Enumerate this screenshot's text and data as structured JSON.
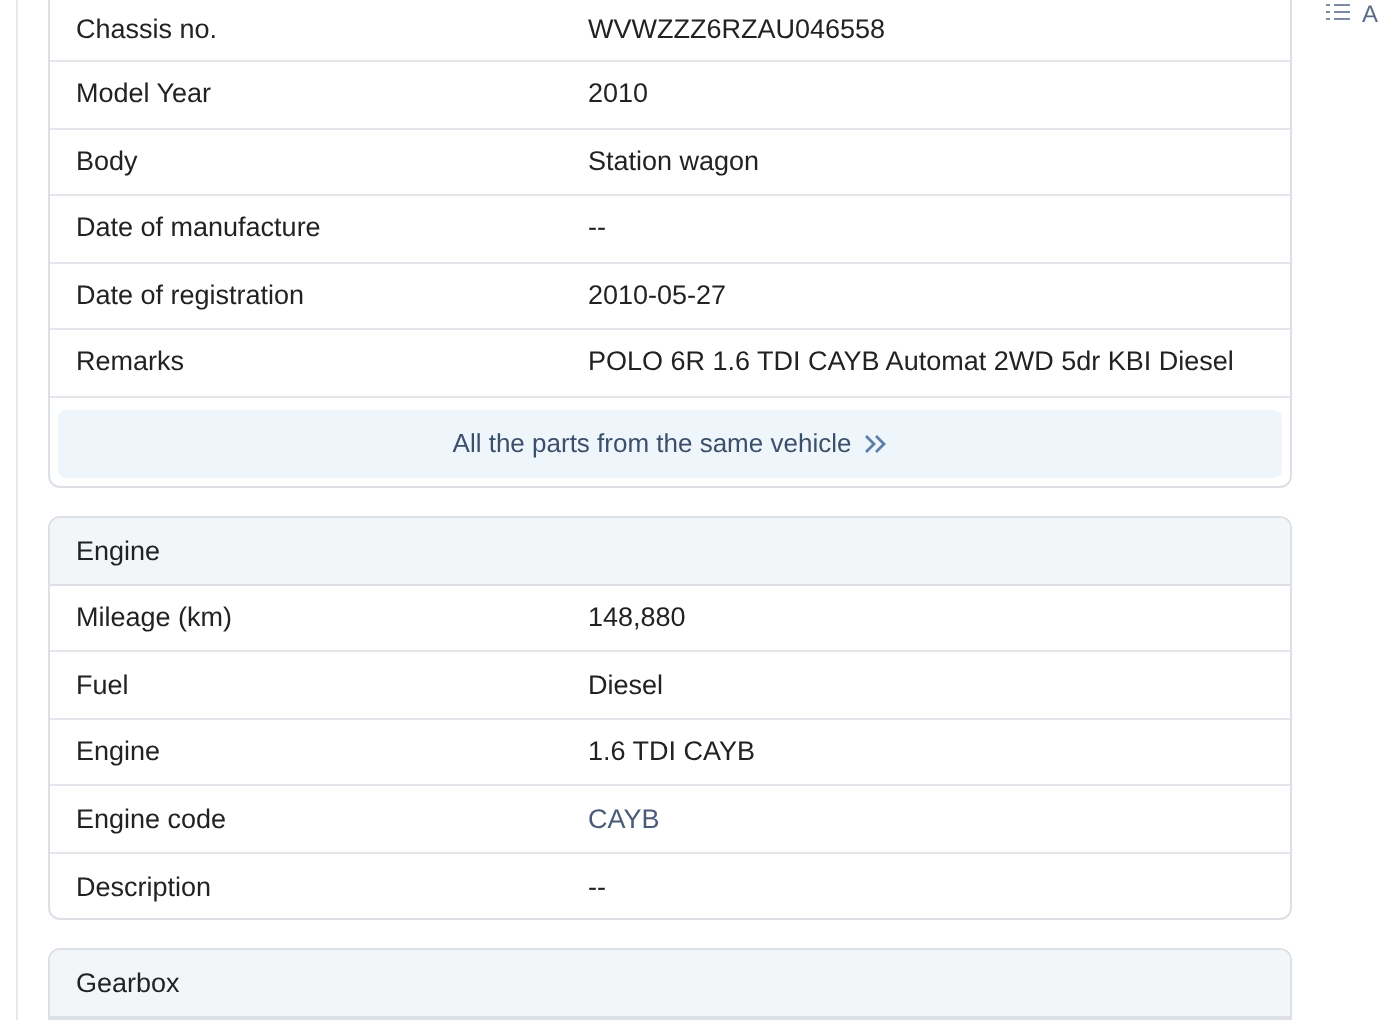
{
  "sections": [
    {
      "rows": [
        {
          "label": "Chassis no.",
          "value": "WVWZZZ6RZAU046558",
          "kind": "text"
        },
        {
          "label": "Model Year",
          "value": "2010",
          "kind": "text"
        },
        {
          "label": "Body",
          "value": "Station wagon",
          "kind": "text"
        },
        {
          "label": "Date of manufacture",
          "value": "--",
          "kind": "text"
        },
        {
          "label": "Date of registration",
          "value": "2010-05-27",
          "kind": "text"
        },
        {
          "label": "Remarks",
          "value": "POLO 6R 1.6 TDI CAYB Automat 2WD 5dr KBI Diesel",
          "kind": "text"
        }
      ],
      "footer_link": "All the parts from the same vehicle"
    },
    {
      "title": "Engine",
      "rows": [
        {
          "label": "Mileage (km)",
          "value": "148,880",
          "kind": "text"
        },
        {
          "label": "Fuel",
          "value": "Diesel",
          "kind": "text"
        },
        {
          "label": "Engine",
          "value": "1.6 TDI CAYB",
          "kind": "text"
        },
        {
          "label": "Engine code",
          "value": "CAYB",
          "kind": "link"
        },
        {
          "label": "Description",
          "value": "--",
          "kind": "text"
        }
      ]
    },
    {
      "title": "Gearbox"
    }
  ],
  "side_link": "A"
}
